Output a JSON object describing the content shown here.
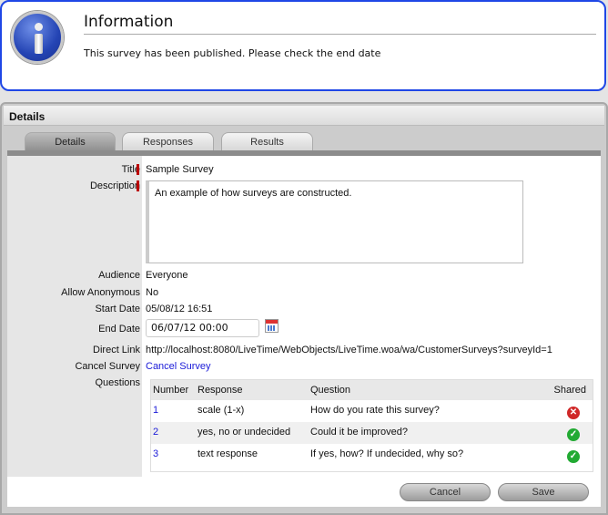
{
  "info": {
    "title": "Information",
    "message": "This survey has been published. Please check the end date",
    "icon": "info-icon"
  },
  "panel": {
    "title": "Details"
  },
  "tabs": [
    {
      "label": "Details",
      "selected": true
    },
    {
      "label": "Responses"
    },
    {
      "label": "Results"
    }
  ],
  "fields": {
    "title": {
      "label": "Title",
      "value": "Sample Survey"
    },
    "description": {
      "label": "Description",
      "value": "An example of how surveys are constructed."
    },
    "audience": {
      "label": "Audience",
      "value": "Everyone"
    },
    "anonymous": {
      "label": "Allow Anonymous",
      "value": "No"
    },
    "start": {
      "label": "Start Date",
      "value": "05/08/12 16:51"
    },
    "end": {
      "label": "End Date",
      "value": "06/07/12 00:00"
    },
    "link": {
      "label": "Direct Link",
      "value": "http://localhost:8080/LiveTime/WebObjects/LiveTime.woa/wa/CustomerSurveys?surveyId=1"
    },
    "cancel": {
      "label": "Cancel Survey",
      "value": "Cancel Survey"
    },
    "questions": {
      "label": "Questions"
    }
  },
  "table": {
    "headers": [
      "Number",
      "Response",
      "Question",
      "Shared"
    ],
    "rows": [
      {
        "number": "1",
        "response": "scale (1-x)",
        "question": "How do you rate this survey?",
        "shared": false
      },
      {
        "number": "2",
        "response": "yes, no or undecided",
        "question": "Could it be improved?",
        "shared": true
      },
      {
        "number": "3",
        "response": "text response",
        "question": "If yes, how? If undecided, why so?",
        "shared": true
      }
    ]
  },
  "buttons": {
    "cancel": "Cancel",
    "save": "Save"
  },
  "colors": {
    "accent": "#1f47e6",
    "required": "#bb0000",
    "shared_yes": "#22aa33",
    "shared_no": "#d02828"
  }
}
